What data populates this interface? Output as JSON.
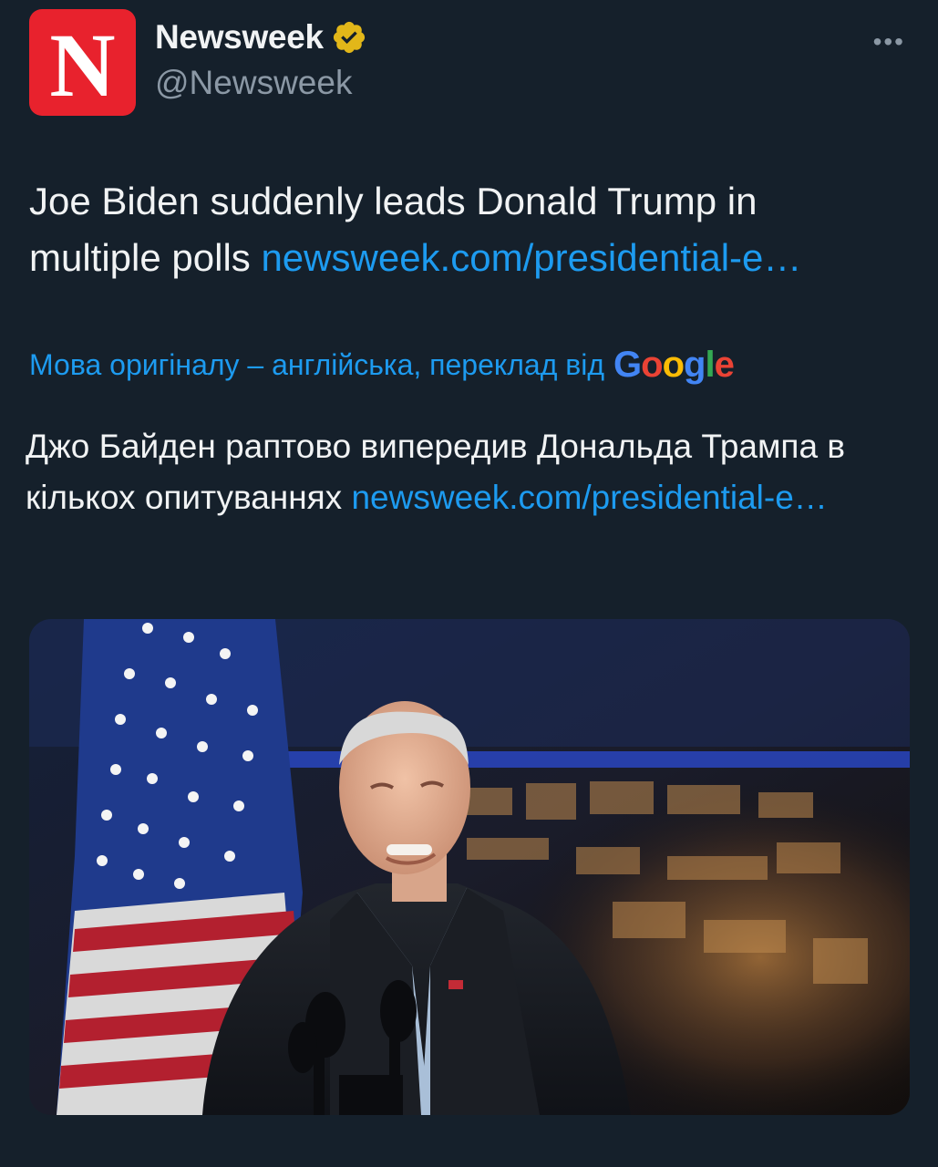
{
  "author": {
    "avatar_letter": "N",
    "display_name": "Newsweek",
    "handle": "@Newsweek",
    "verified_icon": "verified-badge-gold",
    "brand_color": "#e8222d"
  },
  "more_label": "•••",
  "tweet": {
    "text": "Joe Biden suddenly leads Donald Trump in multiple polls ",
    "link": "newsweek.com/presidential-e…"
  },
  "translation": {
    "label": "Мова оригіналу – англійська, переклад від",
    "provider": [
      "G",
      "o",
      "o",
      "g",
      "l",
      "e"
    ],
    "provider_colors": [
      "#4285f4",
      "#ea4335",
      "#fbbc05",
      "#4285f4",
      "#34a853",
      "#ea4335"
    ],
    "text": "Джо Байден раптово випередив Дональда Трампа в кількох опитуваннях ",
    "link": "newsweek.com/presidential-e…"
  },
  "colors": {
    "background": "#15202b",
    "link": "#1d9bf0",
    "secondary": "#8b98a5"
  }
}
